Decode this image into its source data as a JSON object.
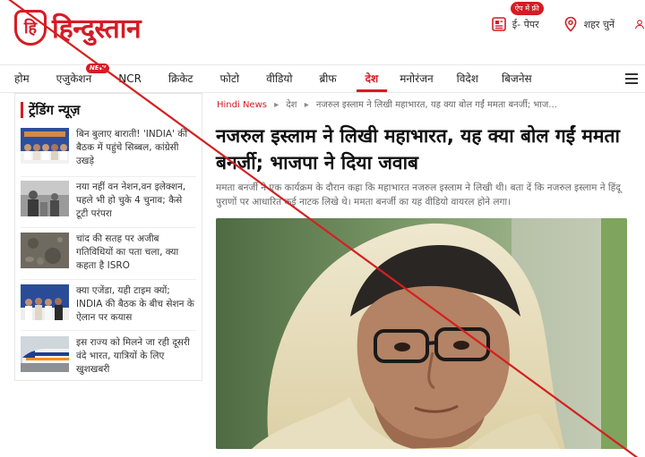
{
  "header": {
    "logo_mark": "हि",
    "logo_text": "हिन्दुस्तान",
    "epaper_badge": "ऐप में फ्री",
    "epaper_label": "ई- पेपर",
    "city_label": "शहर चुनें",
    "icons": [
      "epaper-icon",
      "location-pin-icon",
      "user-icon"
    ]
  },
  "nav": {
    "items": [
      "होम",
      "एजुकेशन",
      "NCR",
      "क्रिकेट",
      "फोटो",
      "वीडियो",
      "ब्रीफ",
      "देश",
      "मनोरंजन",
      "विदेश",
      "बिजनेस"
    ],
    "new_badge": "NEW",
    "active": "देश"
  },
  "sidebar": {
    "title": "ट्रेंडिंग न्यूज़",
    "items": [
      {
        "text": "बिन बुलाए बाराती! 'INDIA' की बैठक में पहुंचे सिब्बल, कांग्रेसी उखड़े"
      },
      {
        "text": "नया नहीं वन नेशन,वन इलेक्शन, पहले भी हो चुके 4 चुनाव; कैसे टूटी परंपरा"
      },
      {
        "text": "चांद की सतह पर अजीब गतिविधियों का पता चला, क्या कहता है ISRO"
      },
      {
        "text": "क्या एजेंडा, यही टाइम क्यों; INDIA की बैठक के बीच सेशन के ऐलान पर कयास"
      },
      {
        "text": "इस राज्य को मिलने जा रही दूसरी वंदे भारत, यात्रियों के लिए खुशखबरी"
      }
    ]
  },
  "breadcrumb": {
    "home": "Hindi News",
    "sep": "▸",
    "section": "देश",
    "current": "नजरुल इस्लाम ने लिखी महाभारत, यह क्या बोल गईं ममता बनर्जी; भाज..."
  },
  "article": {
    "headline": "नजरुल इस्लाम ने लिखी महाभारत, यह क्या बोल गईं ममता बनर्जी; भाजपा ने दिया जवाब",
    "summary": "ममता बनर्जी ने एक कार्यक्रम के दौरान कहा कि महाभारत नजरुल इस्लाम ने लिखी थी। बता दें कि नजरुल इस्लाम ने हिंदू पुराणों पर आधारित कई नाटक लिखे थे। ममता बनर्जी का यह वीडियो वायरल होने लगा।"
  },
  "colors": {
    "brand_red": "#d51c24",
    "overlay_line": "#d42020"
  }
}
